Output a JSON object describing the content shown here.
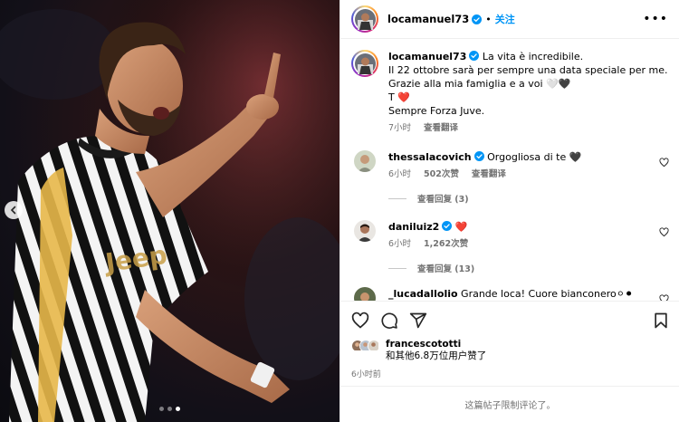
{
  "post": {
    "author": "locamanuel73",
    "follow_label": "关注",
    "separator": "•",
    "more_label": "•••",
    "caption_lines": [
      "La vita è incredibile.",
      "Il 22 ottobre sarà per sempre una data speciale per me.",
      "Grazie alla mia famiglia e a voi 🤍🖤",
      "T ❤️",
      "Sempre Forza Juve."
    ],
    "caption_time": "7小时",
    "see_translation": "查看翻译",
    "carousel": {
      "total": 3,
      "active": 3
    }
  },
  "comments": [
    {
      "username": "thessalacovich",
      "verified": true,
      "text": "Orgogliosa di te 🖤",
      "time": "6小时",
      "likes": "502次赞",
      "translate": "查看翻译",
      "replies": "查看回复 (3)"
    },
    {
      "username": "daniluiz2",
      "verified": true,
      "text": "❤️",
      "time": "6小时",
      "likes": "1,262次赞",
      "replies": "查看回复 (13)"
    },
    {
      "username": "_lucadallolio",
      "verified": false,
      "text": "Grande loca! Cuore bianconero⚪⚫"
    }
  ],
  "likes": {
    "first_liker": "francescototti",
    "summary": "和其他6.8万位用户赞了"
  },
  "posted_time": "6小时前",
  "comments_limited": "这篇帖子限制评论了。",
  "colors": {
    "link_blue": "#0095f6",
    "muted": "#737373",
    "border": "#efefef",
    "heart_red": "#ed4956"
  },
  "icons": [
    "chevron-left-icon",
    "verified-badge-icon",
    "heart-icon",
    "comment-icon",
    "share-icon",
    "bookmark-icon",
    "more-icon"
  ]
}
